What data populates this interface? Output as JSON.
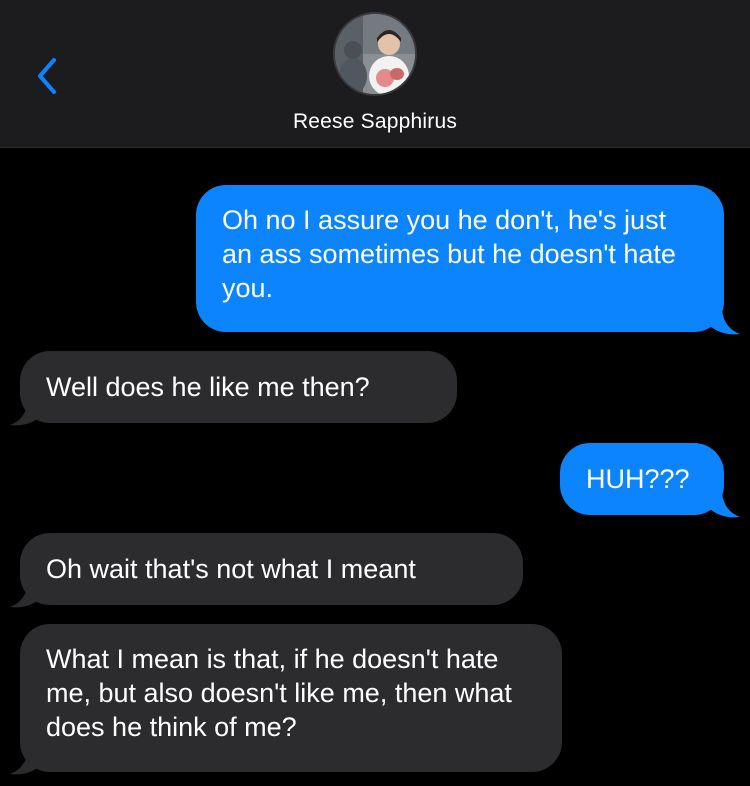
{
  "header": {
    "contact_name": "Reese Sapphirus",
    "back_icon": "chevron-left-icon",
    "accent_color": "#0b84fe"
  },
  "messages": [
    {
      "direction": "sent",
      "text": "Oh no I assure you he don't, he's just an ass sometimes but he doesn't hate you."
    },
    {
      "direction": "received",
      "text": "Well does he like me then?"
    },
    {
      "direction": "sent",
      "text": "HUH???"
    },
    {
      "direction": "received",
      "text": "Oh wait that's not what I meant"
    },
    {
      "direction": "received",
      "text": "What I mean is that, if he doesn't hate me, but also doesn't like me, then what does he think of me?"
    }
  ],
  "colors": {
    "sent_bubble": "#0b84fe",
    "received_bubble": "#2c2c2e",
    "header_bg": "#1c1c1e",
    "background": "#000000"
  }
}
